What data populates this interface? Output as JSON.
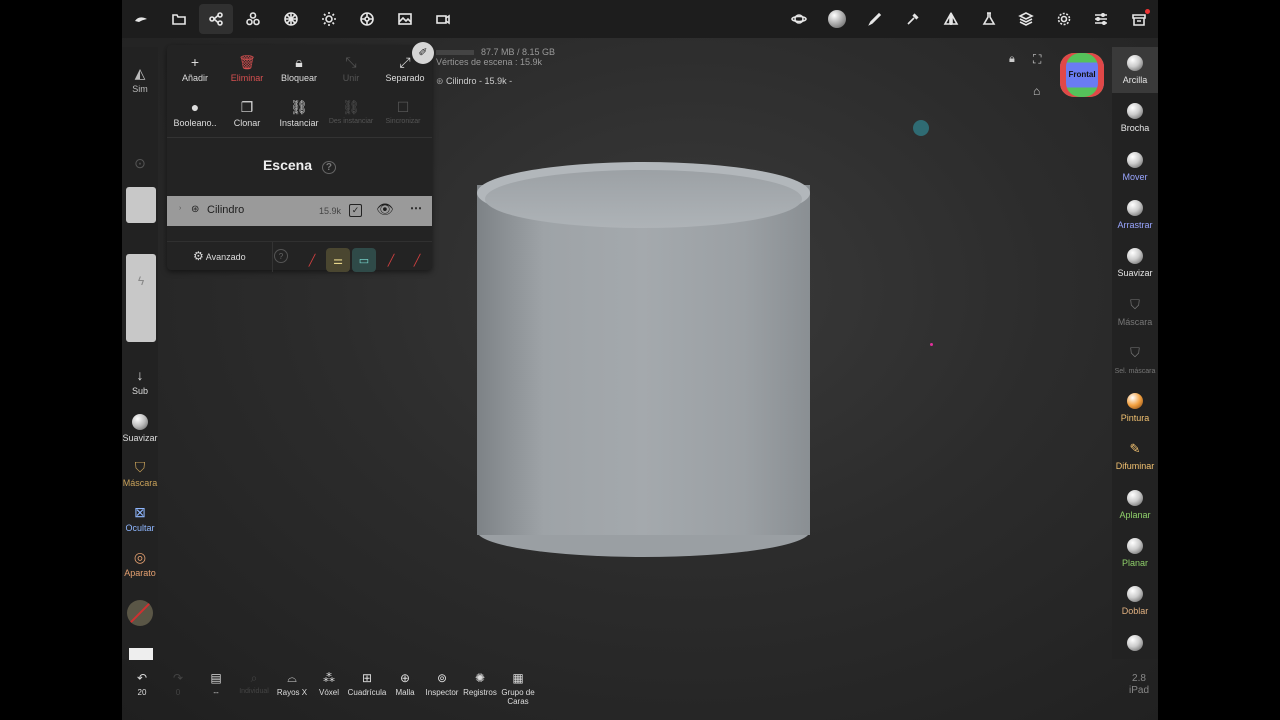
{
  "stats": {
    "memory": "87.7 MB / 8.15 GB",
    "vertices": "Vértices de escena : 15.9k",
    "selection": "Cilindro - 15.9k -"
  },
  "left_tools": {
    "sim": "Sim",
    "sub": "Sub",
    "smooth": "Suavizar",
    "mask": "Máscara",
    "hide": "Ocultar",
    "gizmo": "Aparato"
  },
  "panel": {
    "add": "Añadir",
    "delete": "Eliminar",
    "lock": "Bloquear",
    "join": "Unir",
    "separate": "Separado",
    "boolean": "Booleano..",
    "clone": "Clonar",
    "instance": "Instanciar",
    "uninstance": "Des instanciar",
    "sync": "Sincronizar",
    "scene_title": "Escena",
    "object_name": "Cilindro",
    "object_count": "15.9k",
    "advanced": "Avanzado"
  },
  "view": {
    "orientation": "Frontal"
  },
  "right_tools": [
    {
      "label": "Arcilla",
      "color": "#e6e6e6"
    },
    {
      "label": "Brocha",
      "color": "#e6e6e6"
    },
    {
      "label": "Mover",
      "color": "#9aa6ff"
    },
    {
      "label": "Arrastrar",
      "color": "#9aa6ff"
    },
    {
      "label": "Suavizar",
      "color": "#e6e6e6"
    },
    {
      "label": "Máscara",
      "color": "#777777"
    },
    {
      "label": "Sel. máscara",
      "color": "#777777"
    },
    {
      "label": "Pintura",
      "color": "#f0c070"
    },
    {
      "label": "Difuminar",
      "color": "#f0c070"
    },
    {
      "label": "Aplanar",
      "color": "#8fd06a"
    },
    {
      "label": "Planar",
      "color": "#8fd06a"
    },
    {
      "label": "Doblar",
      "color": "#e0b080"
    }
  ],
  "bottom": {
    "undo_count": "20",
    "redo_count": "0",
    "individual": "Individual",
    "xray": "Rayos X",
    "voxel": "Vóxel",
    "grid": "Cuadrícula",
    "mesh": "Malla",
    "inspector": "Inspector",
    "logs": "Registros",
    "facegroup": "Grupo de Caras",
    "version": "2.8",
    "device": "iPad"
  }
}
